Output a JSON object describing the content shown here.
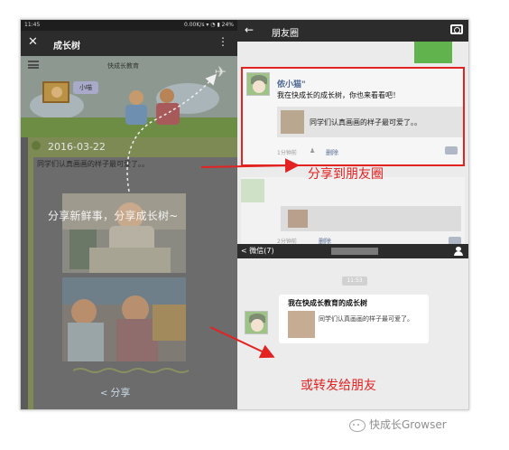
{
  "left_panel": {
    "status_time": "11:45",
    "status_right": "0.00K/s",
    "battery": "24%",
    "header_title": "成长树",
    "banner_title": "快成长教育",
    "banner_name": "小喵",
    "post_date": "2016-03-22",
    "post_text": "同学们认真画画的样子最可爱了。。",
    "overlay_text": "分享新鲜事，分享成长树~",
    "share_label": "分享"
  },
  "right_panel": {
    "header_title": "朋友圈",
    "moment": {
      "name": "侬小猫\"",
      "text": "我在快成长的成长树，你也来看看吧！",
      "card_text": "同学们认真画画的样子最可爱了。。",
      "time": "1分钟前",
      "delete": "删除"
    },
    "label_share_moments": "分享到朋友圈",
    "blurred_time": "2分钟前",
    "blurred_delete": "删除",
    "chat_header": "微信(7)",
    "chat_time": "11:53",
    "bubble": {
      "title": "我在快成长教育的成长树",
      "content": "同学们认真画画的样子最可爱了。"
    },
    "label_forward": "或转发给朋友"
  },
  "footer": {
    "watermark": "快成长Growser"
  },
  "colors": {
    "annotation_red": "#e32222",
    "wechat_dark": "#2c2c2c"
  },
  "icons": [
    "close-icon",
    "more-icon",
    "menu-icon",
    "paper-plane-icon",
    "share-icon",
    "back-arrow-icon",
    "camera-icon",
    "person-icon",
    "wechat-icon",
    "comment-icon"
  ]
}
